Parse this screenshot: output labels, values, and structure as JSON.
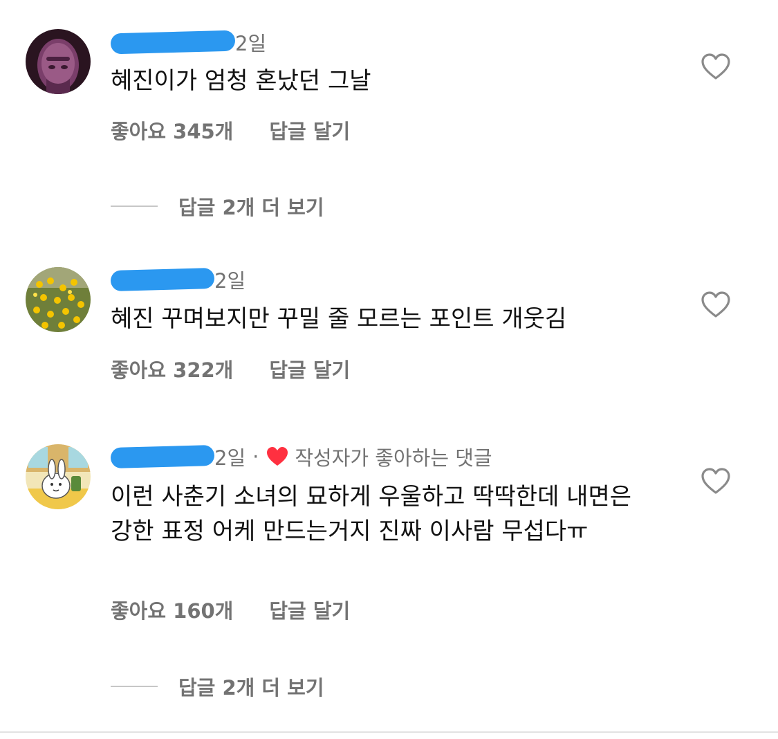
{
  "colors": {
    "muted": "#737373",
    "redaction": "#2b98f0",
    "liked_heart": "#ff3040"
  },
  "comments": [
    {
      "avatar": "thanos-avatar",
      "time": "2일",
      "text": "혜진이가 엄청 혼났던 그날",
      "likes": "좋아요 345개",
      "reply": "답글 달기",
      "view_replies": "답글 2개 더 보기"
    },
    {
      "avatar": "yellow-flowers-avatar",
      "time": "2일",
      "text": "혜진 꾸며보지만 꾸밀 줄 모르는 포인트 개웃김",
      "likes": "좋아요 322개",
      "reply": "답글 달기"
    },
    {
      "avatar": "cartoon-bunny-avatar",
      "time": "2일",
      "separator": "·",
      "liked_by_author": "작성자가 좋아하는 댓글",
      "text": "이런 사춘기 소녀의 묘하게 우울하고 딱딱한데 내면은 강한 표정 어케 만드는거지 진짜 이사람 무섭다ㅠ",
      "likes": "좋아요 160개",
      "reply": "답글 달기",
      "view_replies": "답글 2개 더 보기"
    }
  ]
}
